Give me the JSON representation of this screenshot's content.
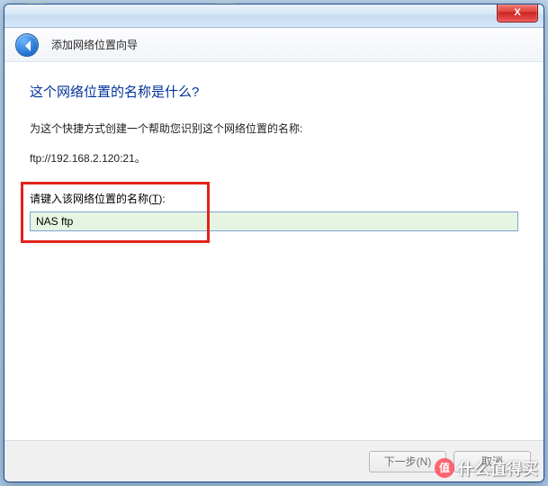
{
  "wizard": {
    "title": "添加网络位置向导",
    "heading": "这个网络位置的名称是什么?",
    "description": "为这个快捷方式创建一个帮助您识别这个网络位置的名称:",
    "url_display": "ftp://192.168.2.120:21。",
    "field_label_pre": "请键入该网络位置的名称(",
    "field_label_key": "T",
    "field_label_post": "):",
    "name_value": "NAS ftp"
  },
  "buttons": {
    "next": "下一步(N)",
    "cancel": "取消",
    "close_x": "X"
  },
  "watermark": {
    "icon": "值",
    "text": "什么值得买"
  }
}
